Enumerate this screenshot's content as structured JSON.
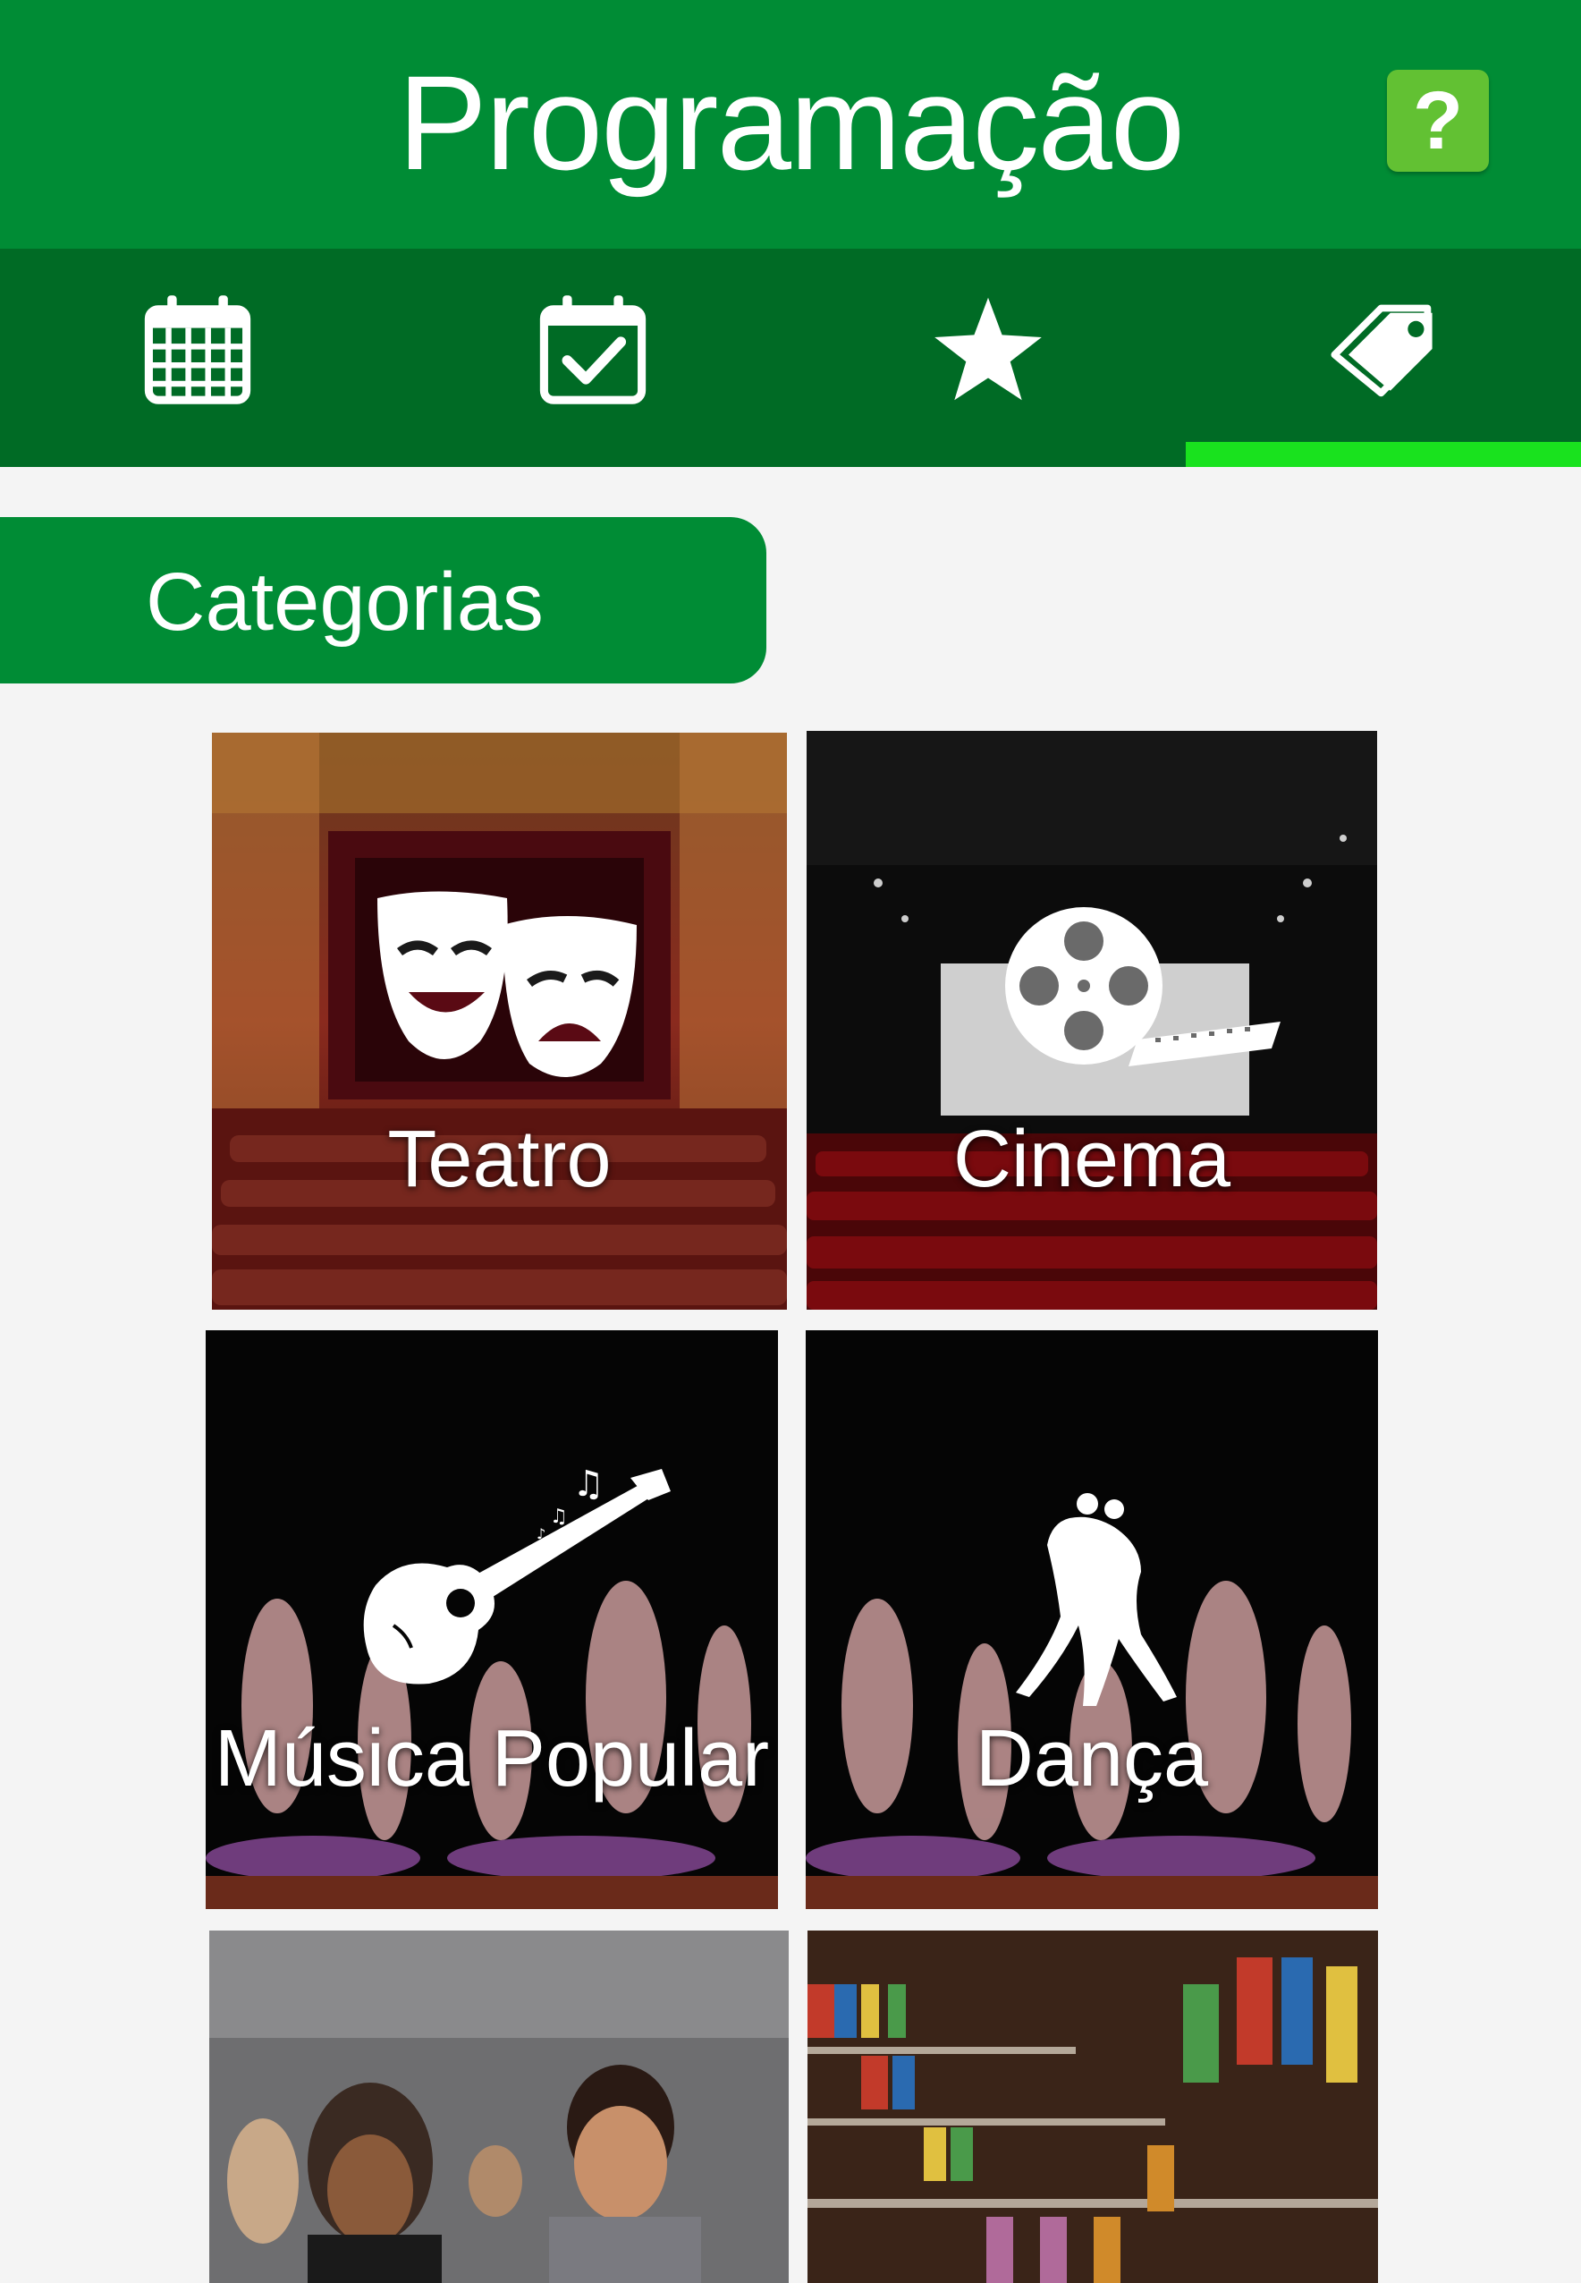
{
  "header": {
    "title": "Programação",
    "help_label": "?"
  },
  "tabs": [
    {
      "name": "calendar"
    },
    {
      "name": "calendar-check"
    },
    {
      "name": "favorites"
    },
    {
      "name": "categories",
      "active": true
    }
  ],
  "section": {
    "title": "Categorias"
  },
  "categories": [
    {
      "label": "Teatro",
      "icon": "theater-masks-icon"
    },
    {
      "label": "Cinema",
      "icon": "film-reel-icon"
    },
    {
      "label": "Música Popular",
      "icon": "guitar-icon"
    },
    {
      "label": "Dança",
      "icon": "dancers-icon"
    },
    {
      "label": "",
      "icon": ""
    },
    {
      "label": "",
      "icon": ""
    }
  ],
  "colors": {
    "header": "#008c35",
    "tabbar": "#006b25",
    "active_indicator": "#19e21e",
    "help_button": "#62c133"
  }
}
